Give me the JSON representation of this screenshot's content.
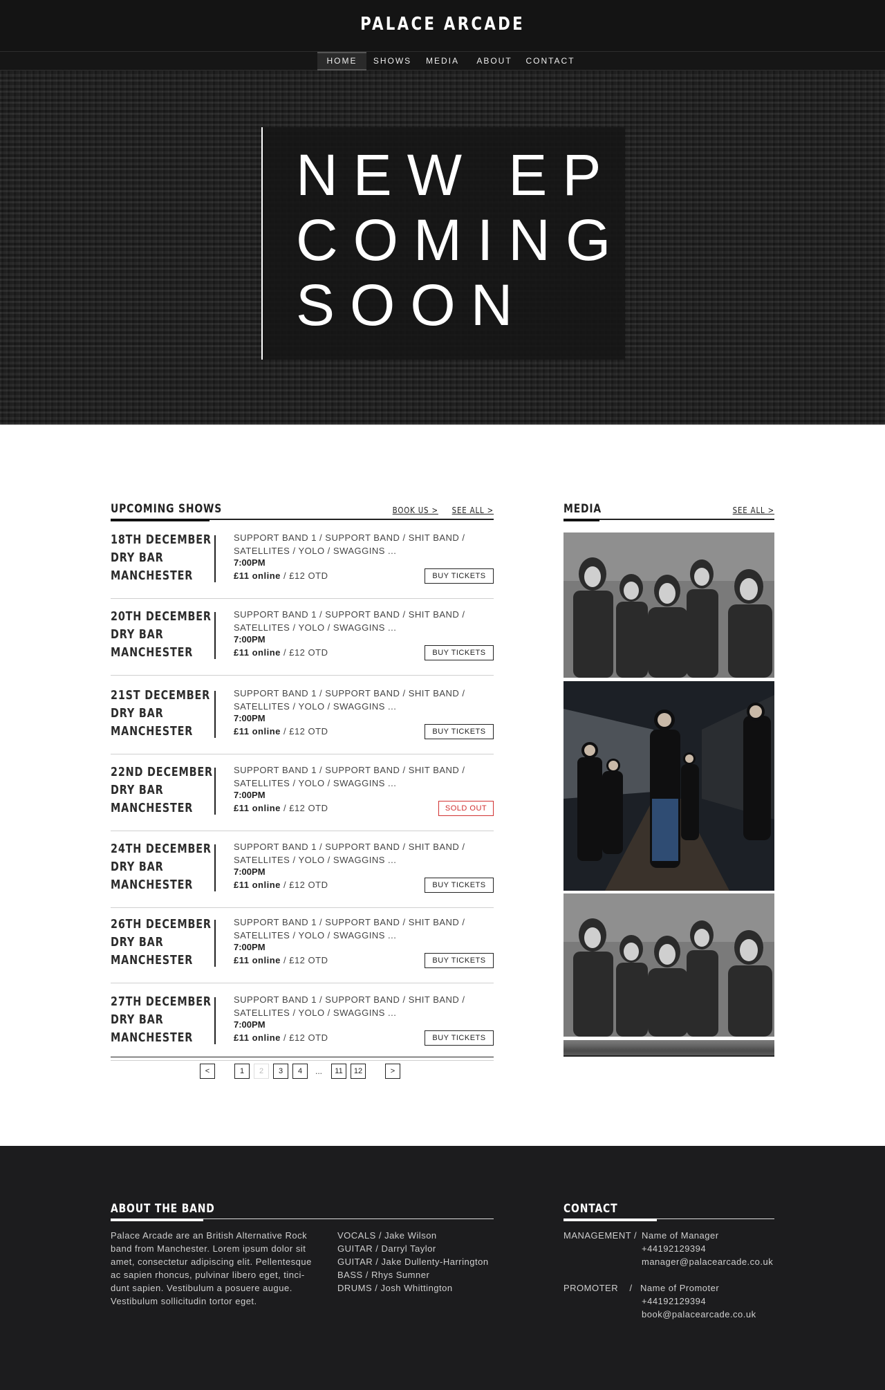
{
  "brand": "PALACE ARCADE",
  "nav": [
    "HOME",
    "SHOWS",
    "MEDIA",
    "ABOUT",
    "CONTACT"
  ],
  "hero": {
    "line1": "NEW EP",
    "line2": "COMING",
    "line3": "SOON"
  },
  "shows": {
    "title": "UPCOMING SHOWS",
    "book_us": "BOOK US >",
    "see_all": "SEE ALL >",
    "items": [
      {
        "date": "18TH DECEMBER",
        "venue": "DRY BAR",
        "city": "MANCHESTER",
        "bands1": "SUPPORT BAND 1 / SUPPORT BAND / SHIT BAND /",
        "bands2": "SATELLITES / YOLO / SWAGGINS ...",
        "time": "7:00PM",
        "price_online": "£11 online",
        "price_otd": " / £12 OTD",
        "button": "BUY TICKETS",
        "sold_out": false
      },
      {
        "date": "20TH DECEMBER",
        "venue": "DRY BAR",
        "city": "MANCHESTER",
        "bands1": "SUPPORT BAND 1 / SUPPORT BAND / SHIT BAND /",
        "bands2": "SATELLITES / YOLO / SWAGGINS ...",
        "time": "7:00PM",
        "price_online": "£11 online",
        "price_otd": " / £12 OTD",
        "button": "BUY TICKETS",
        "sold_out": false
      },
      {
        "date": "21ST DECEMBER",
        "venue": "DRY BAR",
        "city": "MANCHESTER",
        "bands1": "SUPPORT BAND 1 / SUPPORT BAND / SHIT BAND /",
        "bands2": "SATELLITES / YOLO / SWAGGINS ...",
        "time": "7:00PM",
        "price_online": "£11 online",
        "price_otd": " / £12 OTD",
        "button": "BUY TICKETS",
        "sold_out": false
      },
      {
        "date": "22ND DECEMBER",
        "venue": "DRY BAR",
        "city": "MANCHESTER",
        "bands1": "SUPPORT BAND 1 / SUPPORT BAND / SHIT BAND /",
        "bands2": "SATELLITES / YOLO / SWAGGINS ...",
        "time": "7:00PM",
        "price_online": "£11 online",
        "price_otd": " / £12 OTD",
        "button": "SOLD OUT",
        "sold_out": true
      },
      {
        "date": "24TH DECEMBER",
        "venue": "DRY BAR",
        "city": "MANCHESTER",
        "bands1": "SUPPORT BAND 1 / SUPPORT BAND / SHIT BAND /",
        "bands2": "SATELLITES / YOLO / SWAGGINS ...",
        "time": "7:00PM",
        "price_online": "£11 online",
        "price_otd": " / £12 OTD",
        "button": "BUY TICKETS",
        "sold_out": false
      },
      {
        "date": "26TH DECEMBER",
        "venue": "DRY BAR",
        "city": "MANCHESTER",
        "bands1": "SUPPORT BAND 1 / SUPPORT BAND / SHIT BAND /",
        "bands2": "SATELLITES / YOLO / SWAGGINS ...",
        "time": "7:00PM",
        "price_online": "£11 online",
        "price_otd": " / £12 OTD",
        "button": "BUY TICKETS",
        "sold_out": false
      },
      {
        "date": "27TH DECEMBER",
        "venue": "DRY BAR",
        "city": "MANCHESTER",
        "bands1": "SUPPORT BAND 1 / SUPPORT BAND / SHIT BAND /",
        "bands2": "SATELLITES / YOLO / SWAGGINS ...",
        "time": "7:00PM",
        "price_online": "£11 online",
        "price_otd": " / £12 OTD",
        "button": "BUY TICKETS",
        "sold_out": false
      }
    ]
  },
  "pagination": {
    "prev": "<",
    "pages": [
      "1",
      "2",
      "3",
      "4"
    ],
    "ellipsis": "...",
    "tail": [
      "11",
      "12"
    ],
    "next": ">",
    "current": "2"
  },
  "media": {
    "title": "MEDIA",
    "see_all": "SEE ALL >"
  },
  "about": {
    "title": "ABOUT THE BAND",
    "text": [
      "Palace Arcade are an British Alternative Rock",
      "band from Manchester. Lorem ipsum dolor sit",
      "amet, consectetur adipiscing elit. Pellentesque",
      "ac sapien rhoncus, pulvinar libero eget, tinci-",
      "dunt sapien. Vestibulum a posuere augue.",
      "Vestibulum sollicitudin tortor eget."
    ],
    "members": [
      "VOCALS / Jake Wilson",
      "GUITAR / Darryl Taylor",
      "GUITAR / Jake Dullenty-Harrington",
      "BASS / Rhys Sumner",
      "DRUMS / Josh Whittington"
    ]
  },
  "contact": {
    "title": "CONTACT",
    "management_label": "MANAGEMENT /",
    "management": [
      "Name of Manager",
      "+44192129394",
      "manager@palacearcade.co.uk"
    ],
    "promoter_label": "PROMOTER    /",
    "promoter": [
      "Name of Promoter",
      "+44192129394",
      "book@palacearcade.co.uk"
    ]
  }
}
